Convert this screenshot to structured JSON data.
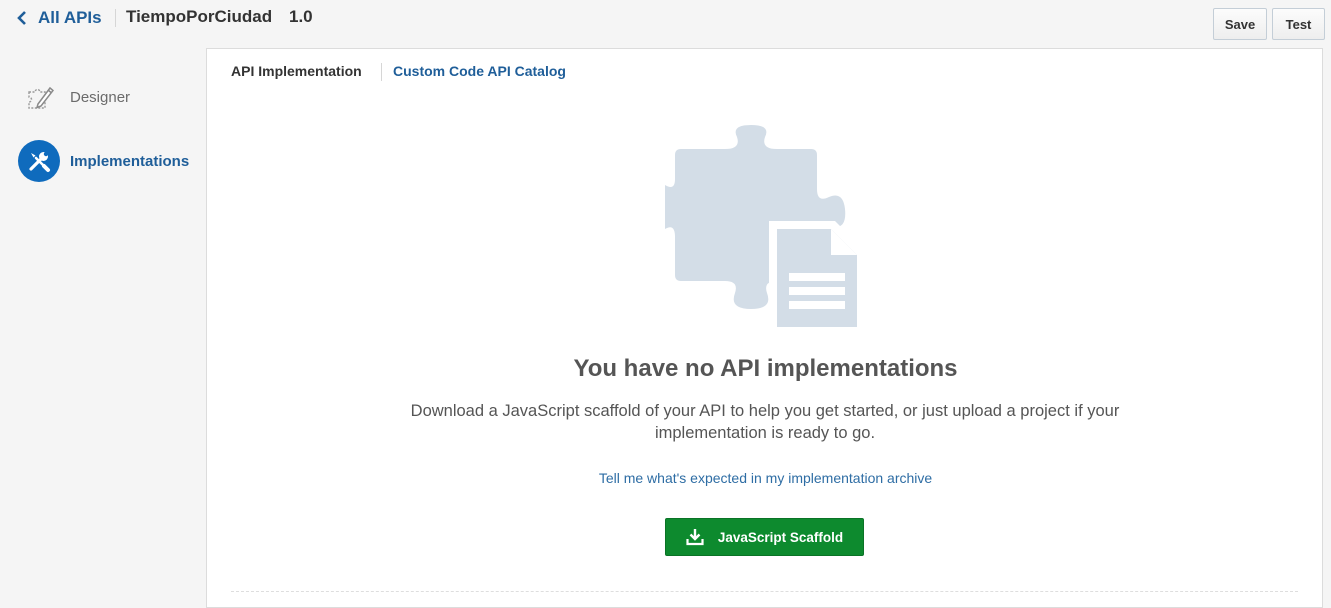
{
  "header": {
    "back_label": "All APIs",
    "api_name": "TiempoPorCiudad",
    "api_version": "1.0",
    "save_label": "Save",
    "test_label": "Test"
  },
  "sidebar": {
    "items": [
      {
        "label": "Designer",
        "icon": "designer-icon",
        "active": false
      },
      {
        "label": "Implementations",
        "icon": "wrench-screwdriver-icon",
        "active": true
      }
    ]
  },
  "main": {
    "tabs": [
      {
        "label": "API Implementation",
        "active": true
      },
      {
        "label": "Custom Code API Catalog",
        "active": false
      }
    ],
    "empty_state": {
      "illustration": "puzzle-document-icon",
      "title": "You have no API implementations",
      "description": "Download a JavaScript scaffold of your API to help you get started, or just upload a project if your implementation is ready to go.",
      "help_link": "Tell me what's expected in my implementation archive",
      "button_label": "JavaScript Scaffold",
      "button_icon": "download-icon"
    }
  },
  "colors": {
    "accent": "#1f5e99",
    "active_circle": "#0f6bbd",
    "primary_button": "#0d8a2e",
    "illustration": "#d3dde7"
  }
}
